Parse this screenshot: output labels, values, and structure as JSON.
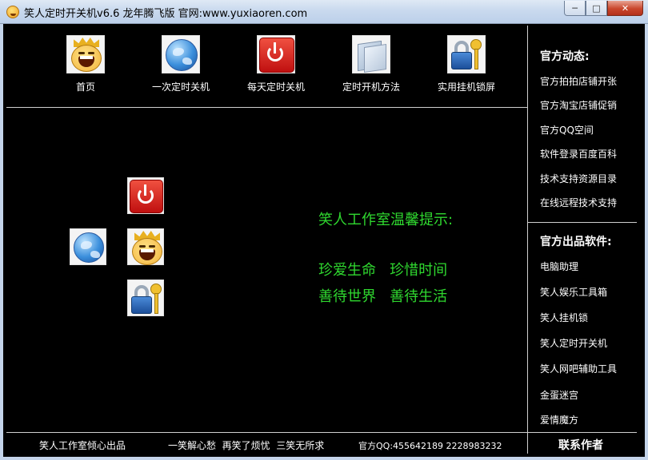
{
  "window": {
    "title": "笑人定时开关机v6.6 龙年腾飞版  官网:www.yuxiaoren.com",
    "minimize_glyph": "─",
    "maximize_glyph": "□",
    "close_glyph": "✕"
  },
  "toolbar": {
    "items": [
      {
        "label": "首页",
        "icon": "laughing-face-icon"
      },
      {
        "label": "一次定时关机",
        "icon": "globe-icon"
      },
      {
        "label": "每天定时关机",
        "icon": "power-icon"
      },
      {
        "label": "定时开机方法",
        "icon": "folder-icon"
      },
      {
        "label": "实用挂机锁屏",
        "icon": "lock-icon"
      }
    ]
  },
  "tips": {
    "heading": "笑人工作室温馨提示:",
    "line1": "珍爱生命   珍惜时间",
    "line2": "善待世界   善待生活"
  },
  "sidebar": {
    "news_heading": "官方动态:",
    "news_links": [
      "官方拍拍店铺开张",
      "官方淘宝店铺促销",
      "官方QQ空间",
      "软件登录百度百科",
      "技术支持资源目录",
      "在线远程技术支持"
    ],
    "products_heading": "官方出品软件:",
    "product_links": [
      "电脑助理",
      "笑人娱乐工具箱",
      "笑人挂机锁",
      "笑人定时开关机",
      "笑人网吧辅助工具",
      "金蛋迷宫",
      "爱情魔方"
    ]
  },
  "footer": {
    "studio": "笑人工作室倾心出品",
    "motto": "一笑解心愁  再笑了烦忧  三笑无所求",
    "qq": "官方QQ:455642189 2228983232",
    "contact": "联系作者"
  }
}
